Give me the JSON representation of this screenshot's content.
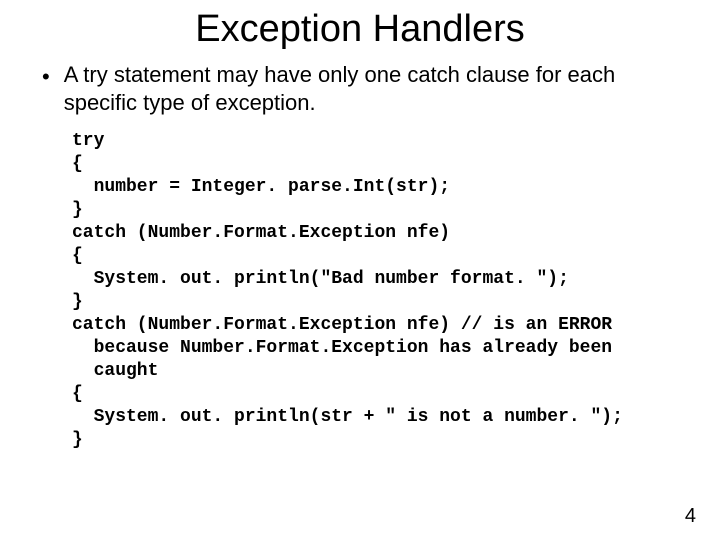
{
  "title": "Exception Handlers",
  "bullet": "A try statement may have only one catch clause for each specific type of exception.",
  "code": "try\n{\n  number = Integer. parse.Int(str);\n}\ncatch (Number.Format.Exception nfe)\n{\n  System. out. println(\"Bad number format. \");\n}\ncatch (Number.Format.Exception nfe) // is an ERROR\n  because Number.Format.Exception has already been\n  caught\n{\n  System. out. println(str + \" is not a number. \");\n}",
  "page_number": "4"
}
